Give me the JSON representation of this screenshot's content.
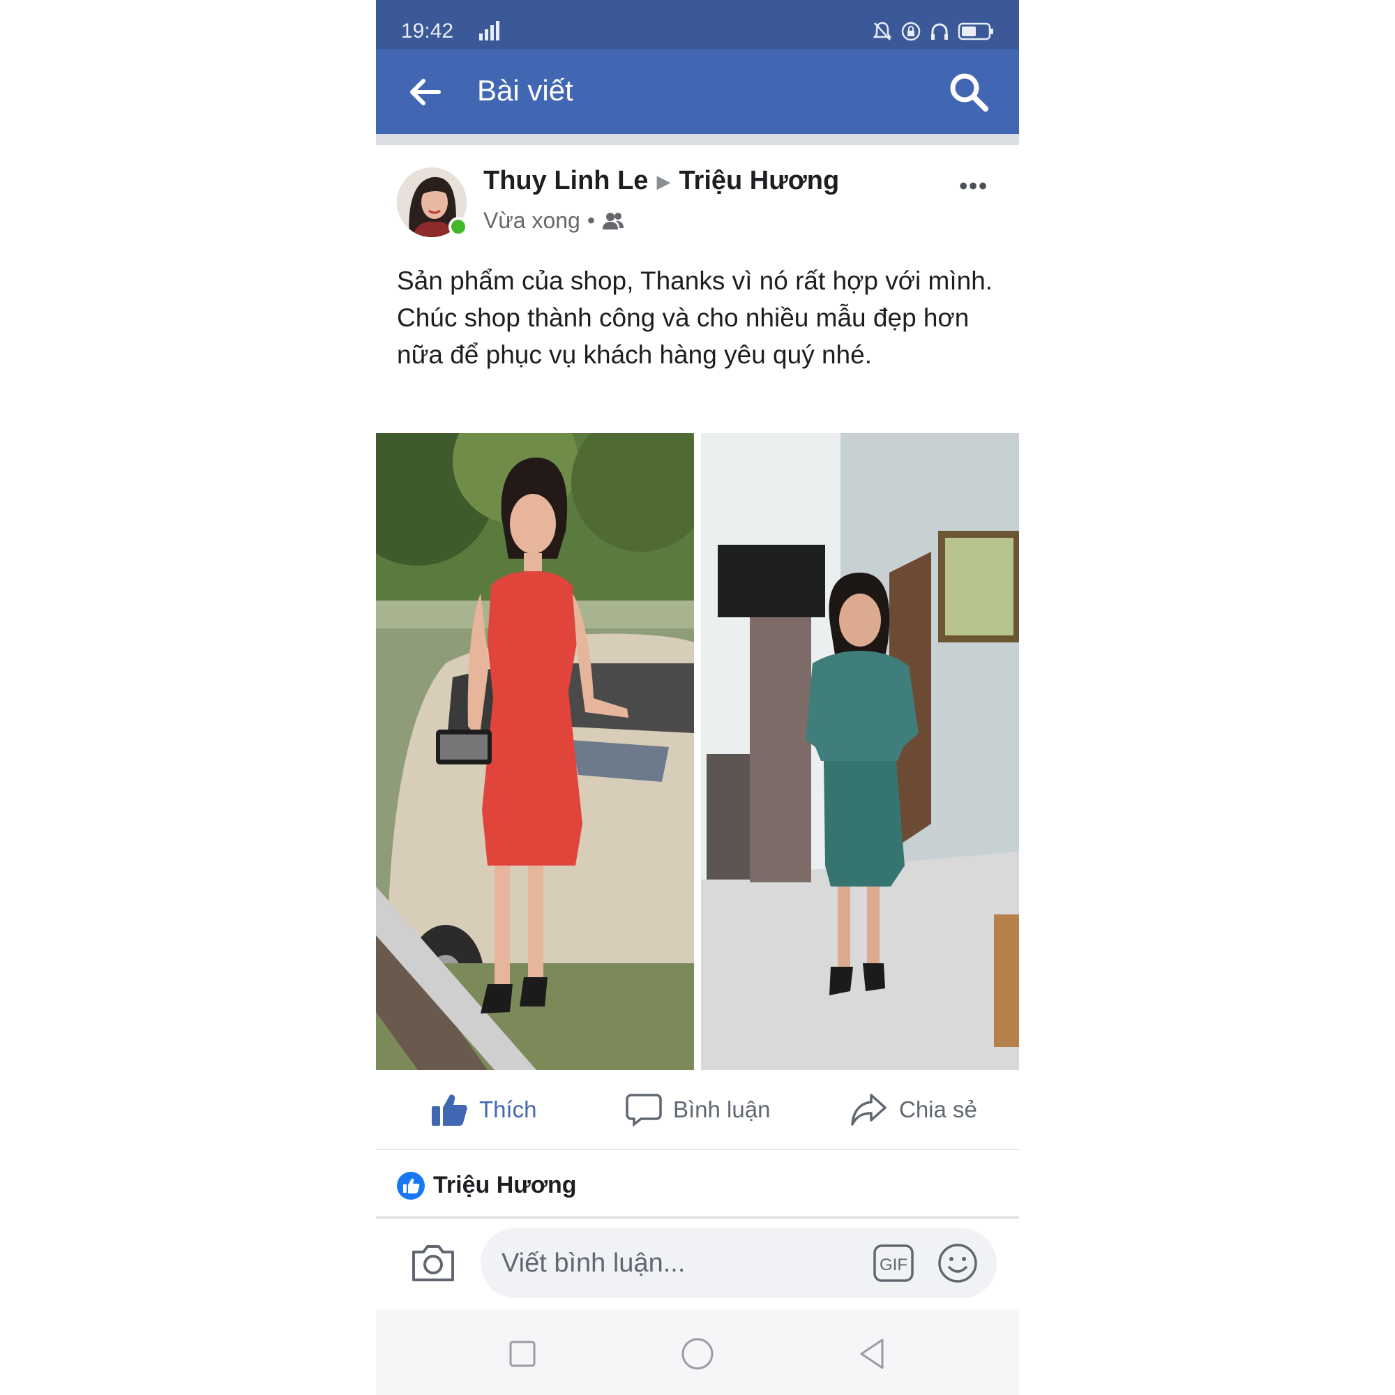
{
  "status_bar": {
    "time": "19:42"
  },
  "app_bar": {
    "title": "Bài viết"
  },
  "post": {
    "author": "Thuy Linh Le",
    "target": "Triệu Hương",
    "time": "Vừa xong",
    "separator": "•",
    "text": "Sản phẩm của shop, Thanks vì nó rất hợp với mình. Chúc shop thành công và cho nhiều mẫu đẹp hơn nữa để phục vụ khách hàng yêu quý nhé.",
    "more": "•••"
  },
  "actions": {
    "like": "Thích",
    "comment": "Bình luận",
    "share": "Chia sẻ"
  },
  "reactions": {
    "liker": "Triệu Hương"
  },
  "composer": {
    "placeholder": "Viết bình luận...",
    "gif": "GIF"
  },
  "colors": {
    "facebook_blue": "#4267b2",
    "status_blue": "#3b5998",
    "online_green": "#42b72a",
    "like_badge": "#1877f2"
  }
}
